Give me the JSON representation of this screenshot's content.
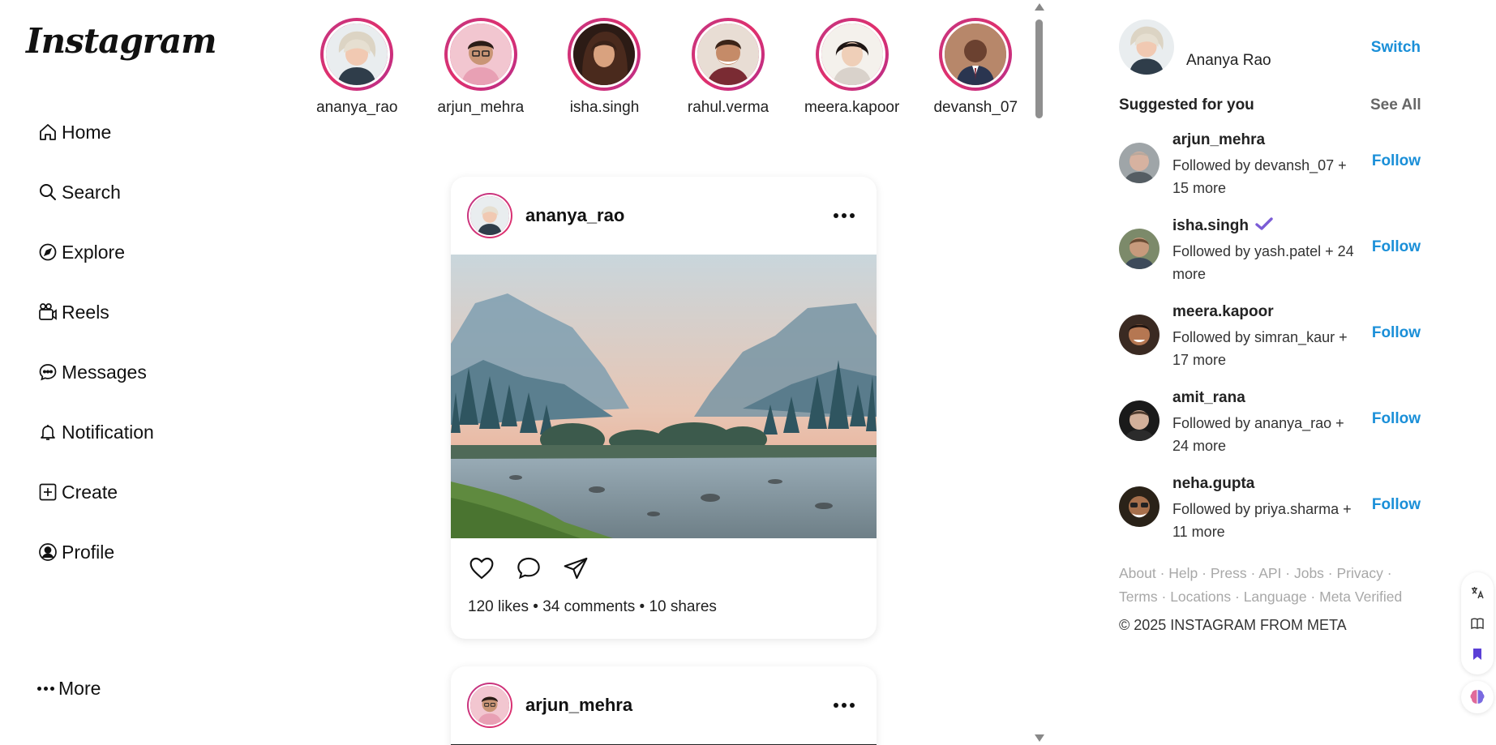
{
  "app": {
    "logo_text": "Instagram"
  },
  "nav": {
    "items": [
      {
        "label": "Home",
        "icon": "home-icon"
      },
      {
        "label": "Search",
        "icon": "search-icon"
      },
      {
        "label": "Explore",
        "icon": "compass-icon"
      },
      {
        "label": "Reels",
        "icon": "reels-icon"
      },
      {
        "label": "Messages",
        "icon": "chat-bubble-icon"
      },
      {
        "label": "Notification",
        "icon": "bell-icon"
      },
      {
        "label": "Create",
        "icon": "plus-square-icon"
      },
      {
        "label": "Profile",
        "icon": "user-circle-icon"
      }
    ],
    "more_label": "More"
  },
  "stories": [
    {
      "username": "ananya_rao"
    },
    {
      "username": "arjun_mehra"
    },
    {
      "username": "isha.singh"
    },
    {
      "username": "rahul.verma"
    },
    {
      "username": "meera.kapoor"
    },
    {
      "username": "devansh_07"
    }
  ],
  "feed": {
    "posts": [
      {
        "username": "ananya_rao",
        "stats": "120 likes • 34 comments • 10 shares",
        "image": "mountain-valley-river-photo"
      },
      {
        "username": "arjun_mehra"
      }
    ]
  },
  "sidebar": {
    "current_user": {
      "display_name": "Ananya Rao",
      "switch_label": "Switch"
    },
    "suggested_title": "Suggested for you",
    "see_all_label": "See All",
    "follow_label": "Follow",
    "suggestions": [
      {
        "username": "arjun_mehra",
        "followed_by": "Followed by devansh_07 + 15 more",
        "verified": false
      },
      {
        "username": "isha.singh",
        "followed_by": "Followed by yash.patel + 24 more",
        "verified": true
      },
      {
        "username": "meera.kapoor",
        "followed_by": "Followed by simran_kaur + 17 more",
        "verified": false
      },
      {
        "username": "amit_rana",
        "followed_by": "Followed by ananya_rao + 24 more",
        "verified": false
      },
      {
        "username": "neha.gupta",
        "followed_by": "Followed by priya.sharma + 11 more",
        "verified": false
      }
    ],
    "footer_links": [
      "About",
      "Help",
      "Press",
      "API",
      "Jobs",
      "Privacy",
      "Terms",
      "Locations",
      "Language",
      "Meta Verified"
    ],
    "copyright": "© 2025 INSTAGRAM FROM META"
  },
  "colors": {
    "link_blue": "#1a8fd8",
    "story_ring": "#c13584",
    "verified": "#7b5cd6"
  }
}
